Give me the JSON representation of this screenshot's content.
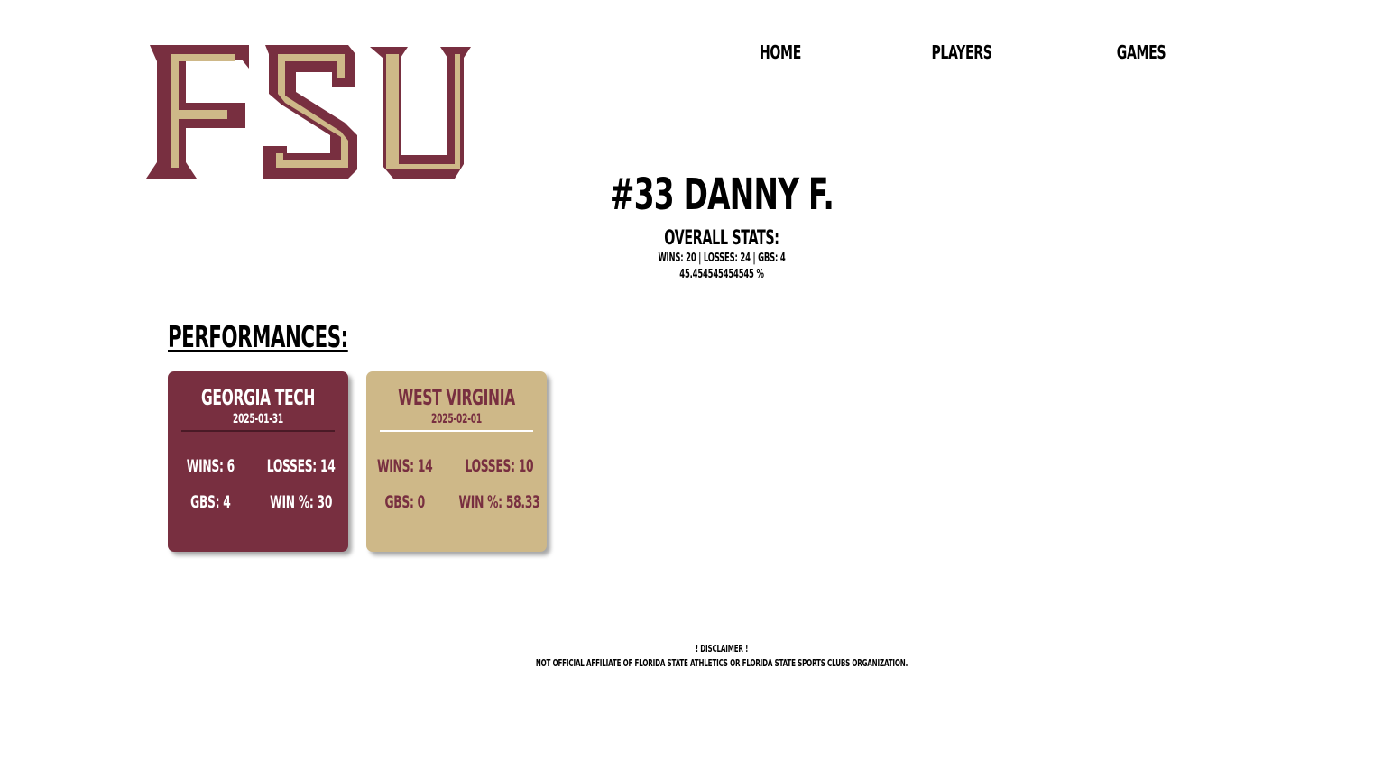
{
  "logo": {
    "text": "FSU",
    "colors": {
      "garnet": "#782f40",
      "gold": "#ceb888"
    }
  },
  "nav": [
    {
      "label": "HOME"
    },
    {
      "label": "PLAYERS"
    },
    {
      "label": "GAMES"
    }
  ],
  "player": {
    "name": "#33 DANNY F.",
    "overall_title": "OVERALL STATS:",
    "overall_line": "WINS: 20 | LOSSES: 24 | GBS: 4",
    "win_pct": "45.454545454545 %"
  },
  "performances": {
    "heading": "PERFORMANCES:",
    "cards": [
      {
        "opponent": "GEORGIA TECH",
        "date": "2025-01-31",
        "wins": "WINS: 6",
        "losses": "LOSSES: 14",
        "gbs": "GBS: 4",
        "win_pct": "WIN %: 30"
      },
      {
        "opponent": "WEST VIRGINIA",
        "date": "2025-02-01",
        "wins": "WINS: 14",
        "losses": "LOSSES: 10",
        "gbs": "GBS: 0",
        "win_pct": "WIN %: 58.33"
      }
    ]
  },
  "disclaimer": {
    "title": "! DISCLAIMER !",
    "text": "NOT OFFICIAL AFFILIATE OF FLORIDA STATE ATHLETICS OR FLORIDA STATE SPORTS CLUBS ORGANIZATION."
  }
}
